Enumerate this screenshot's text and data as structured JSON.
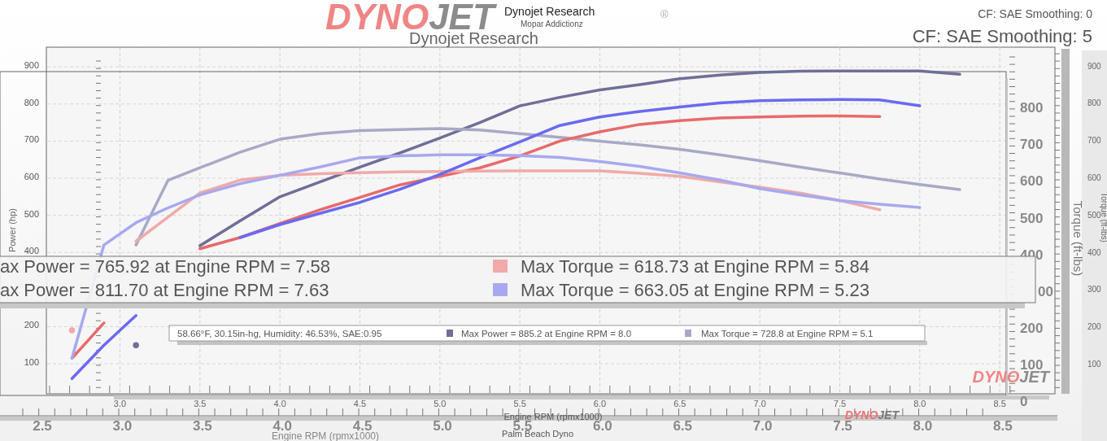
{
  "header": {
    "logo": [
      {
        "text": "DYNO",
        "color": "#f08585"
      },
      {
        "text": "JET",
        "color": "#8c8c8c"
      }
    ],
    "registered": "®",
    "title_small": "Dynojet Research",
    "subtitle": "Mopar Addictionz",
    "title_large": "Dynojet Research",
    "cf_small": "CF: SAE Smoothing: 0",
    "cf_large": "CF: SAE Smoothing: 5"
  },
  "right_axis_large": {
    "label": "Torque (ft-lbs)",
    "ticks": [
      "800",
      "700",
      "600",
      "500",
      "400",
      "00",
      "200",
      "100",
      "0"
    ]
  },
  "right_axis_small": {
    "label": "Torque (ft-lbs)",
    "ticks": [
      "900",
      "800",
      "700",
      "600",
      "500",
      "400",
      "300",
      "200",
      "100"
    ]
  },
  "x_axis_large": {
    "label": "Engine RPM (rpmx1000)",
    "ticks": [
      "2.5",
      "3.0",
      "3.5",
      "4.0",
      "4.5",
      "5.0",
      "5.5",
      "6.0",
      "6.5",
      "7.0",
      "7.5",
      "8.0",
      "8.5"
    ]
  },
  "location": "Palm Beach Dyno",
  "chart": {
    "chart_data": {
      "type": "line",
      "xlabel": "Engine RPM (rpmx1000)",
      "ylabel": "Power (hp)",
      "xlim": [
        2.25,
        8.54
      ],
      "ylim": [
        19,
        953
      ],
      "grid": true,
      "legend": true,
      "xticks": [
        {
          "value": 3.0,
          "label": "3.0"
        },
        {
          "value": 3.5,
          "label": "3.5"
        },
        {
          "value": 4.0,
          "label": "4.0"
        },
        {
          "value": 4.5,
          "label": "4.5"
        },
        {
          "value": 5.0,
          "label": "5.0"
        },
        {
          "value": 5.5,
          "label": "5.5"
        },
        {
          "value": 6.0,
          "label": "6.0"
        },
        {
          "value": 6.5,
          "label": "6.5"
        },
        {
          "value": 7.0,
          "label": "7.0"
        },
        {
          "value": 7.5,
          "label": "7.5"
        },
        {
          "value": 8.0,
          "label": "8.0"
        },
        {
          "value": 8.5,
          "label": "8.5"
        }
      ],
      "yticks": [
        {
          "value": 100,
          "label": "100"
        },
        {
          "value": 200,
          "label": "200"
        },
        {
          "value": 400,
          "label": "400"
        },
        {
          "value": 500,
          "label": "500"
        },
        {
          "value": 600,
          "label": "600"
        },
        {
          "value": 700,
          "label": "700"
        },
        {
          "value": 800,
          "label": "800"
        },
        {
          "value": 900,
          "label": "900"
        }
      ],
      "x": [
        2.7,
        2.9,
        3.1,
        3.3,
        3.5,
        3.75,
        4.0,
        4.25,
        4.5,
        4.75,
        5.0,
        5.25,
        5.5,
        5.75,
        6.0,
        6.25,
        6.5,
        6.75,
        7.0,
        7.25,
        7.5,
        7.75,
        8.0,
        8.25
      ],
      "series": [
        {
          "name": "Max Power = 885.2 at Engine RPM = 8.0",
          "color": "#6e6f99",
          "values": [
            null,
            null,
            150,
            null,
            418,
            485,
            550,
            590,
            630,
            668,
            708,
            750,
            795,
            818,
            838,
            852,
            868,
            878,
            885,
            888,
            889,
            889,
            889,
            880
          ]
        },
        {
          "name": "Max Torque = 728.8 at Engine RPM = 5.1",
          "color": "#a7a9c8",
          "values": [
            null,
            null,
            420,
            594,
            628,
            670,
            705,
            720,
            728,
            731,
            734,
            730,
            720,
            710,
            700,
            690,
            678,
            663,
            647,
            630,
            614,
            598,
            583,
            569
          ]
        },
        {
          "name": "ax Power = 765.92 at Engine RPM = 7.58",
          "color": "#e86a6a",
          "values": [
            115,
            210,
            null,
            null,
            410,
            440,
            478,
            515,
            548,
            582,
            605,
            628,
            660,
            700,
            725,
            745,
            755,
            762,
            765,
            767,
            768,
            766,
            null,
            null
          ]
        },
        {
          "name": "Max Torque = 618.73 at Engine RPM = 5.84",
          "color": "#f0aaa8",
          "values": [
            190,
            null,
            430,
            495,
            560,
            595,
            608,
            612,
            615,
            617,
            618,
            619,
            620,
            620,
            620,
            613,
            605,
            590,
            576,
            560,
            540,
            515,
            null,
            null
          ]
        },
        {
          "name": "ax Power = 811.70 at Engine RPM = 7.63",
          "color": "#6a6af0",
          "values": [
            60,
            150,
            230,
            null,
            null,
            440,
            475,
            505,
            535,
            570,
            610,
            655,
            698,
            742,
            765,
            780,
            792,
            803,
            809,
            811,
            812,
            811,
            795,
            null
          ]
        },
        {
          "name": "Max Torque = 663.05 at Engine RPM = 5.23",
          "color": "#a8a8f0",
          "values": [
            115,
            420,
            480,
            520,
            555,
            585,
            608,
            630,
            655,
            660,
            663,
            663,
            661,
            656,
            645,
            632,
            614,
            595,
            572,
            555,
            540,
            530,
            521,
            null
          ]
        }
      ]
    }
  },
  "legend_small": {
    "conditions": "58.66°F, 30.15in-hg, Humidity: 46.53%, SAE:0.95"
  },
  "corner_logos": [
    [
      {
        "text": "DYNO",
        "color": "#f08585"
      },
      {
        "text": "JET",
        "color": "#8c8c8c"
      }
    ],
    [
      {
        "text": "DYNO",
        "color": "#ee7070"
      },
      {
        "text": "JET",
        "color": "#7a7a7a"
      }
    ]
  ]
}
